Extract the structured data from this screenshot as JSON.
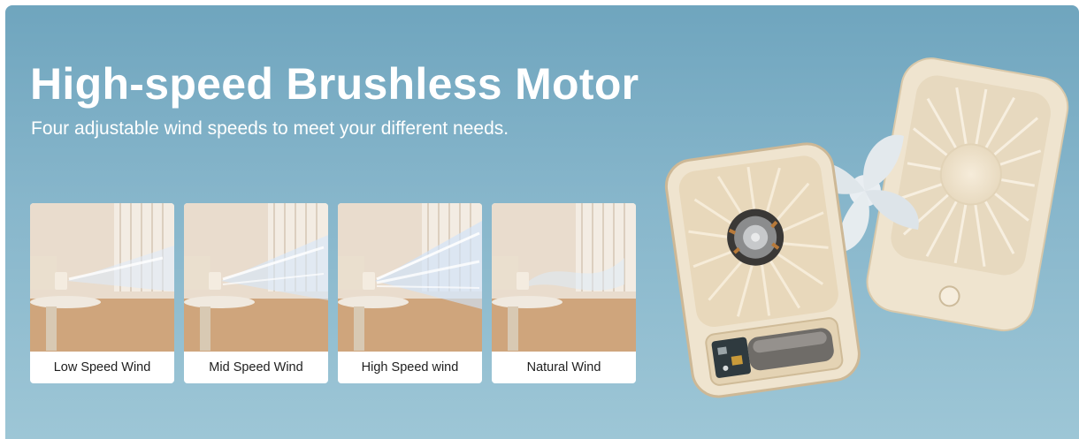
{
  "headline": "High-speed Brushless Motor",
  "subheadline": "Four adjustable wind speeds to meet your different needs.",
  "cards": [
    {
      "label": "Low Speed Wind",
      "level": 1
    },
    {
      "label": "Mid Speed Wind",
      "level": 2
    },
    {
      "label": "High Speed wind",
      "level": 3
    },
    {
      "label": "Natural Wind",
      "level": 0
    }
  ],
  "colors": {
    "background_top": "#6fa5be",
    "background_bottom": "#9dc6d6",
    "fan_body": "#efe4cf",
    "text_light": "#ffffff",
    "text_dark": "#1e1e1e"
  }
}
